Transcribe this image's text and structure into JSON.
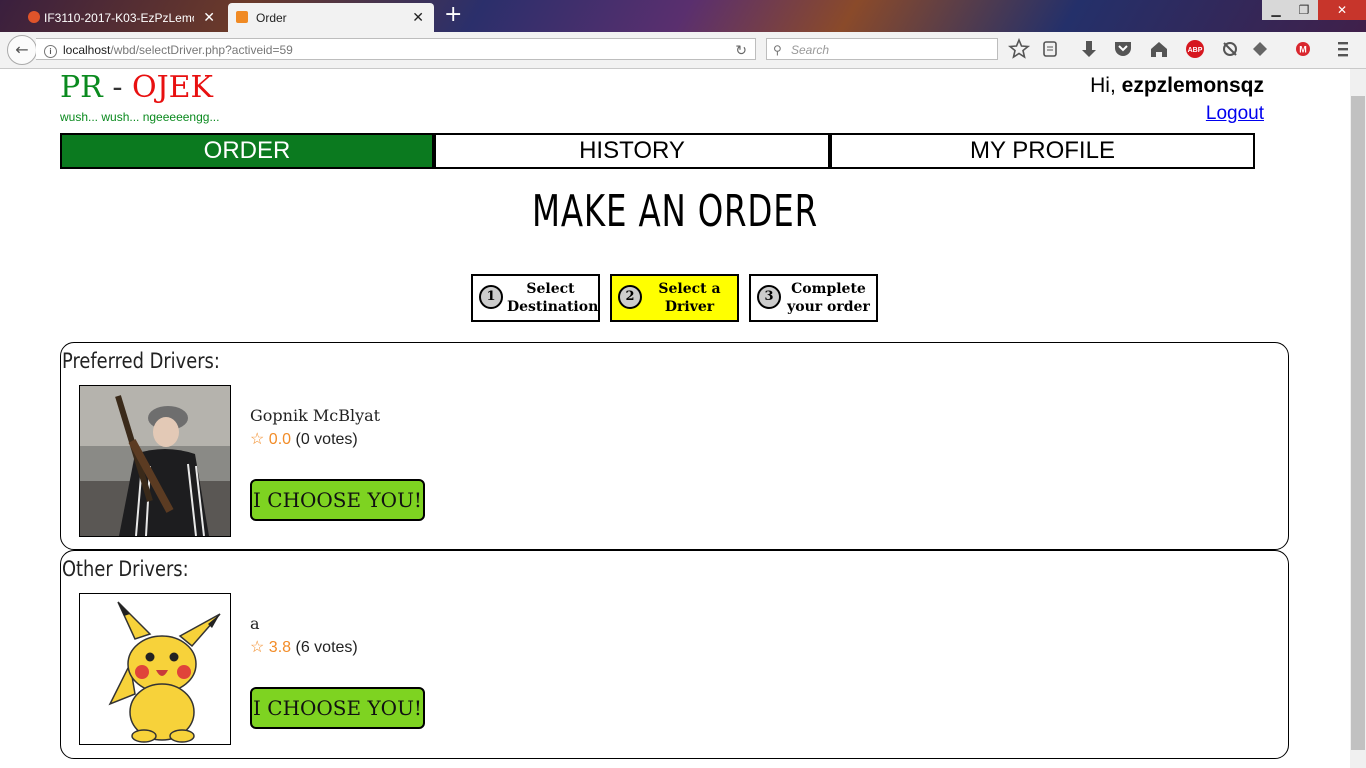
{
  "browser": {
    "tabs": [
      {
        "title": "IF3110-2017-K03-EzPzLemon",
        "active": false
      },
      {
        "title": "Order",
        "active": true
      }
    ],
    "url_host": "localhost",
    "url_path": "/wbd/selectDriver.php?activeid=59",
    "search_placeholder": "Search",
    "extension_badges": {
      "abp": "ABP",
      "mega": "M"
    }
  },
  "header": {
    "logo_pr": "PR",
    "logo_dash": "-",
    "logo_ojek": "OJEK",
    "tagline": "wush... wush... ngeeeeengg...",
    "greeting_prefix": "Hi,",
    "username": "ezpzlemonsqz",
    "logout": "Logout"
  },
  "nav": {
    "order": "ORDER",
    "history": "HISTORY",
    "profile": "MY PROFILE"
  },
  "page_title": "MAKE AN ORDER",
  "steps": [
    {
      "num": "1",
      "line1": "Select",
      "line2": "Destination"
    },
    {
      "num": "2",
      "line1": "Select a",
      "line2": "Driver"
    },
    {
      "num": "3",
      "line1": "Complete",
      "line2": "your order"
    }
  ],
  "preferred": {
    "title": "Preferred Drivers:",
    "driver": {
      "name": "Gopnik McBlyat",
      "star": "☆",
      "score": "0.0",
      "votes": "(0 votes)",
      "button": "I CHOOSE YOU!"
    }
  },
  "other": {
    "title": "Other Drivers:",
    "driver": {
      "name": "a",
      "star": "☆",
      "score": "3.8",
      "votes": "(6 votes)",
      "button": "I CHOOSE YOU!"
    }
  },
  "colors": {
    "brand_green": "#0b7a1f",
    "brand_red": "#e81010",
    "active_step": "#ffff00",
    "button_green": "#7ed321",
    "star_orange": "#f28c28"
  }
}
